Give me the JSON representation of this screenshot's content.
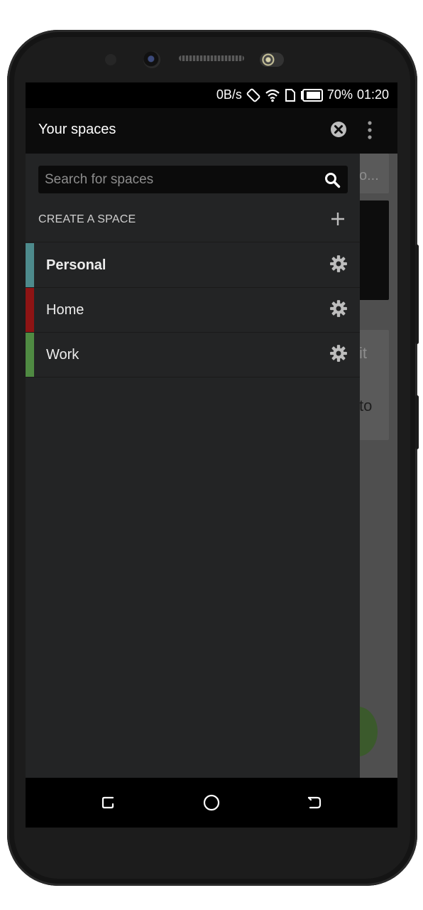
{
  "status_bar": {
    "network_speed": "0B/s",
    "battery_percent": "70%",
    "time": "01:20",
    "icons": [
      "rotate-lock-icon",
      "wifi-icon",
      "sim-icon",
      "battery-icon"
    ]
  },
  "drawer": {
    "title": "Your spaces",
    "close_icon": "close-circle-icon",
    "menu_icon": "more-vert-icon",
    "search": {
      "placeholder": "Search for spaces",
      "value": ""
    },
    "create_label": "CREATE A SPACE",
    "spaces": [
      {
        "label": "Personal",
        "color": "#4d8a8c",
        "active": true
      },
      {
        "label": "Home",
        "color": "#8e1414",
        "active": false
      },
      {
        "label": "Work",
        "color": "#4f8a42",
        "active": false
      }
    ]
  },
  "background_app": {
    "snippets": [
      "o...",
      "it",
      "to"
    ]
  },
  "nav_bar": {
    "icons": [
      "recents-icon",
      "home-icon",
      "back-icon"
    ]
  },
  "colors": {
    "drawer_bg": "#232425",
    "header_bg": "#0c0c0c",
    "text_primary": "#ececec"
  }
}
